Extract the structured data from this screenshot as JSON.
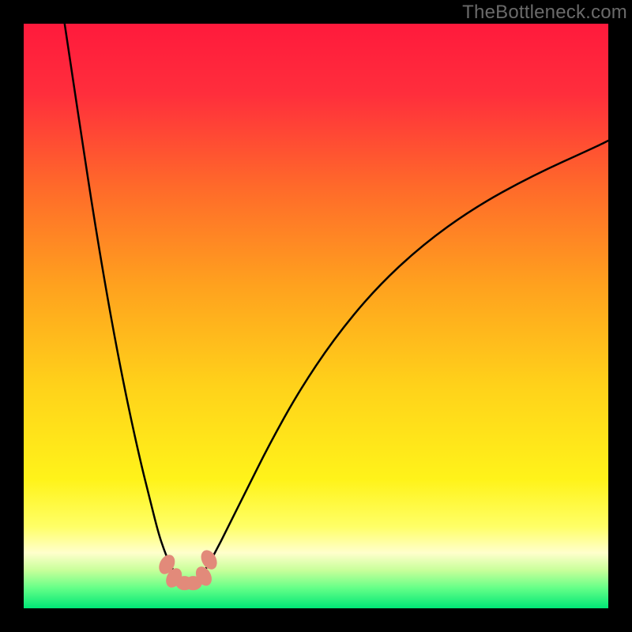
{
  "watermark": "TheBottleneck.com",
  "chart_data": {
    "type": "line",
    "title": "",
    "xlabel": "",
    "ylabel": "",
    "xlim": [
      0,
      100
    ],
    "ylim": [
      0,
      100
    ],
    "grid": false,
    "background_gradient": {
      "stops": [
        {
          "offset": 0.0,
          "color": "#ff1a3c"
        },
        {
          "offset": 0.12,
          "color": "#ff2e3c"
        },
        {
          "offset": 0.28,
          "color": "#ff6a2a"
        },
        {
          "offset": 0.45,
          "color": "#ffa21e"
        },
        {
          "offset": 0.62,
          "color": "#ffd21a"
        },
        {
          "offset": 0.78,
          "color": "#fff31a"
        },
        {
          "offset": 0.86,
          "color": "#ffff66"
        },
        {
          "offset": 0.905,
          "color": "#ffffcc"
        },
        {
          "offset": 0.935,
          "color": "#c8ff9a"
        },
        {
          "offset": 0.965,
          "color": "#66ff88"
        },
        {
          "offset": 1.0,
          "color": "#00e676"
        }
      ]
    },
    "series": [
      {
        "name": "left-branch",
        "x": [
          7.0,
          8.5,
          10.0,
          12.0,
          14.0,
          16.0,
          18.0,
          20.0,
          21.5,
          23.0,
          24.0,
          25.0,
          25.8
        ],
        "y": [
          100.0,
          90.0,
          80.0,
          67.0,
          55.0,
          44.0,
          34.0,
          25.0,
          19.0,
          13.0,
          10.0,
          7.5,
          6.2
        ]
      },
      {
        "name": "right-branch",
        "x": [
          31.0,
          32.5,
          35.0,
          38.0,
          42.0,
          47.0,
          53.0,
          60.0,
          68.0,
          77.0,
          87.0,
          98.0,
          100.0
        ],
        "y": [
          6.5,
          9.0,
          14.0,
          20.0,
          28.0,
          37.0,
          46.0,
          54.5,
          62.0,
          68.5,
          74.0,
          79.0,
          80.0
        ]
      }
    ],
    "marker_cluster": {
      "name": "bottom-dots",
      "color": "#e28a7a",
      "points": [
        {
          "x": 24.5,
          "y": 7.5
        },
        {
          "x": 25.7,
          "y": 5.2
        },
        {
          "x": 27.5,
          "y": 4.3
        },
        {
          "x": 29.0,
          "y": 4.3
        },
        {
          "x": 30.8,
          "y": 5.5
        },
        {
          "x": 31.7,
          "y": 8.3
        }
      ]
    }
  }
}
